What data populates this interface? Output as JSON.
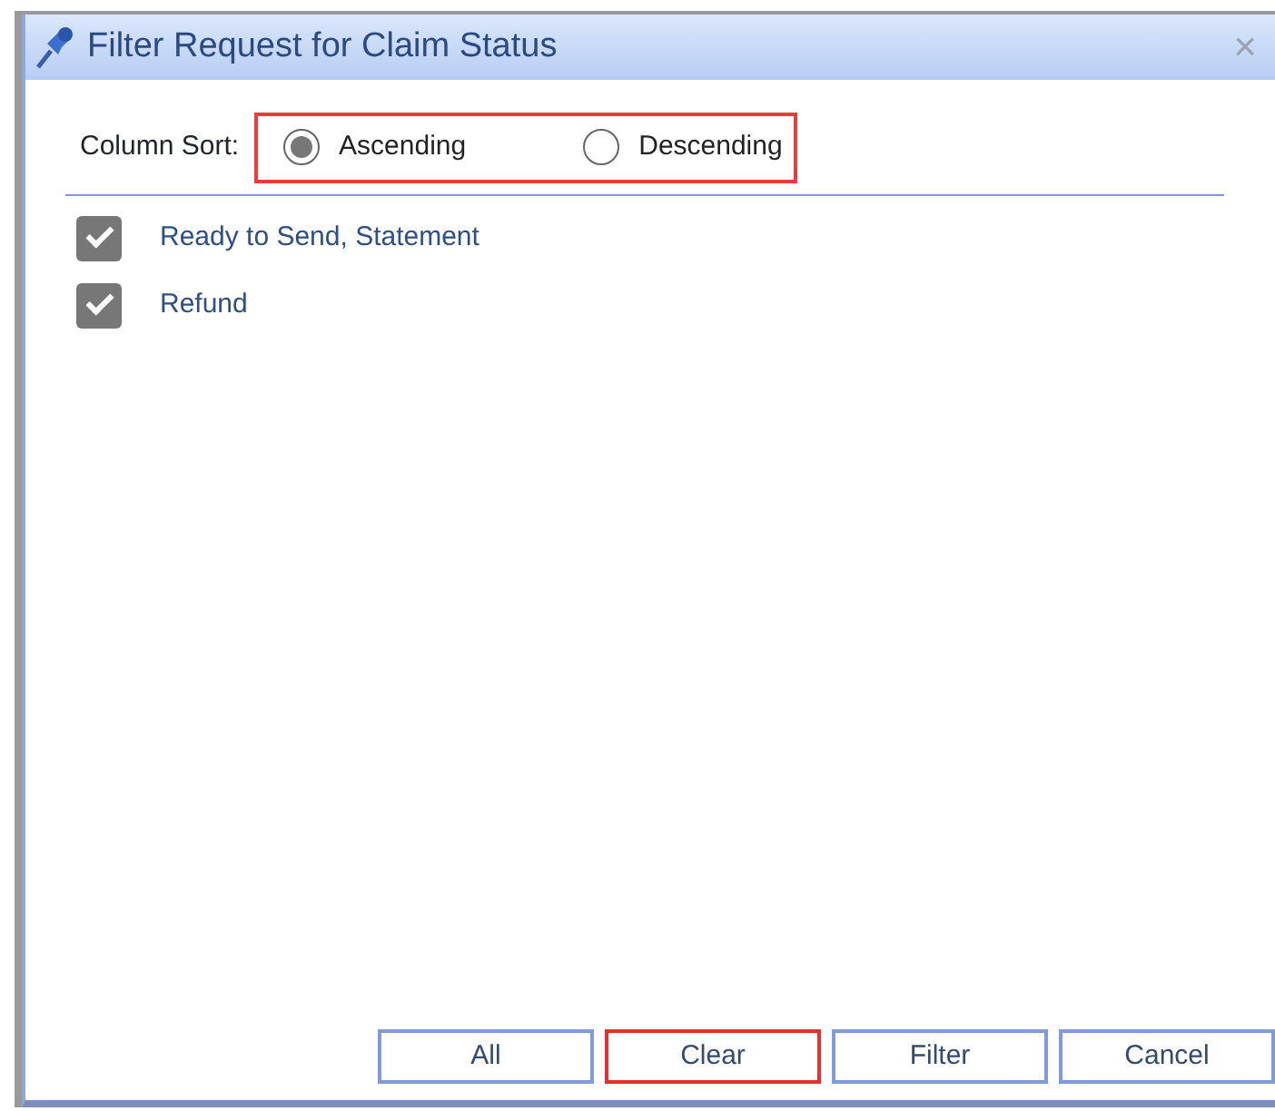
{
  "window": {
    "title": "Filter Request for Claim Status",
    "close": "×"
  },
  "sort": {
    "label": "Column Sort:",
    "highlighted": true,
    "options": [
      {
        "label": "Ascending",
        "selected": true
      },
      {
        "label": "Descending",
        "selected": false
      }
    ]
  },
  "items": [
    {
      "label": "Ready to Send, Statement",
      "checked": true
    },
    {
      "label": "Refund",
      "checked": true
    }
  ],
  "buttons": [
    {
      "label": "All",
      "highlighted": false
    },
    {
      "label": "Clear",
      "highlighted": true
    },
    {
      "label": "Filter",
      "highlighted": false
    },
    {
      "label": "Cancel",
      "highlighted": false
    }
  ]
}
